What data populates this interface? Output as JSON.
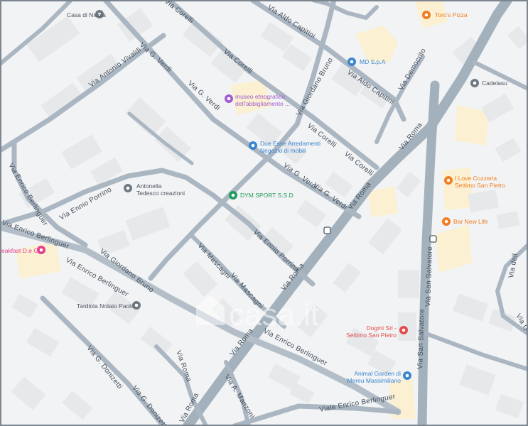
{
  "colors": {
    "background": "#f2f3f4",
    "block": "#e6e8ea",
    "building": "#dcdfe2",
    "road": "#aab6c1",
    "main_road": "#a3b1bd",
    "commercial": "#fbf0d2",
    "poi_orange": "#f07d22",
    "poi_blue": "#3a86d0",
    "poi_pink": "#e33f8f",
    "poi_purple": "#a35bd1",
    "poi_green": "#1f9c5d",
    "poi_red": "#e44a4a",
    "poi_gray": "#6f7982",
    "frame": "#7d868f"
  },
  "streets": [
    {
      "id": "via-aldo-capitini-1",
      "name": "Via Aldo Capitini"
    },
    {
      "id": "via-aldo-capitini-2",
      "name": "Via Aldo Capitini"
    },
    {
      "id": "via-corelli-1",
      "name": "Via Corelli"
    },
    {
      "id": "via-corelli-2",
      "name": "Via Corelli"
    },
    {
      "id": "via-corelli-3",
      "name": "Via Corelli"
    },
    {
      "id": "via-corelli-4",
      "name": "Via Corelli"
    },
    {
      "id": "via-g-verdi-1",
      "name": "Via G. Verdi"
    },
    {
      "id": "via-g-verdi-2",
      "name": "Via G. Verdi"
    },
    {
      "id": "via-g-verdi-3",
      "name": "Via G. Verdi"
    },
    {
      "id": "via-g-verdi-4",
      "name": "Via G. Verdi"
    },
    {
      "id": "via-antonio-vivaldi",
      "name": "Via Antonio Vivaldi"
    },
    {
      "id": "via-giordano-bruno-1",
      "name": "Via Giordano Bruno"
    },
    {
      "id": "via-giordano-bruno-2",
      "name": "Via Giordano Bruno"
    },
    {
      "id": "via-democrito",
      "name": "Via Democrito"
    },
    {
      "id": "via-roma-1",
      "name": "Via Roma"
    },
    {
      "id": "via-roma-2",
      "name": "Via Roma"
    },
    {
      "id": "via-roma-3",
      "name": "Via Roma"
    },
    {
      "id": "via-roma-4",
      "name": "Via Roma"
    },
    {
      "id": "via-roma-5",
      "name": "Via Roma"
    },
    {
      "id": "via-roma-6",
      "name": "Via Roma"
    },
    {
      "id": "via-enrico-berlinguer-1",
      "name": "Via Enrico Berlinguer"
    },
    {
      "id": "via-enrico-berlinguer-2",
      "name": "Via Enrico Berlinguer"
    },
    {
      "id": "via-enrico-berlinguer-3",
      "name": "Via Enrico Berlinguer"
    },
    {
      "id": "via-enrico-berlinguer-4",
      "name": "Via Enrico Berlinguer"
    },
    {
      "id": "via-ennio-porrino-1",
      "name": "Via Ennio Porrino"
    },
    {
      "id": "via-ennio-porrino-2",
      "name": "Via Ennio Porrino"
    },
    {
      "id": "via-mascagni-1",
      "name": "Via Mascagni"
    },
    {
      "id": "via-mascagni-2",
      "name": "Via Mascagni"
    },
    {
      "id": "via-g-donizetti-1",
      "name": "Via G. Donizetti"
    },
    {
      "id": "via-g-donizetti-2",
      "name": "Via G. Donizetti"
    },
    {
      "id": "via-a-manzoni",
      "name": "Via A. Manzoni"
    },
    {
      "id": "viale-enrico-berlinguer",
      "name": "Viale Enrico Berlinguer"
    },
    {
      "id": "via-san-salvatore-1",
      "name": "Via San Salvatore"
    },
    {
      "id": "via-san-salvatore-2",
      "name": "Via San Salvatore"
    },
    {
      "id": "via-delle-1",
      "name": "Via dell"
    },
    {
      "id": "via-g-1",
      "name": "Via G"
    }
  ],
  "pois": [
    {
      "id": "casa-di-nicola",
      "label": "Casa di Nicola",
      "sub": "",
      "icon": "place-pin",
      "color": "#6f7982"
    },
    {
      "id": "toros-pizza",
      "label": "Toro's Pizza",
      "sub": "",
      "icon": "restaurant-fork-knife",
      "color": "#f07d22"
    },
    {
      "id": "md-spa",
      "label": "MD S.p.A",
      "sub": "",
      "icon": "shopping-cart",
      "color": "#3a86d0"
    },
    {
      "id": "cadelasu",
      "label": "Cadelasu",
      "sub": "",
      "icon": "place-pin",
      "color": "#6f7982"
    },
    {
      "id": "museo",
      "label": "museo etnografico",
      "sub": "dell'abbigliamento ...",
      "icon": "museum",
      "color": "#a35bd1"
    },
    {
      "id": "due-esse",
      "label": "Due Esse Arredamenti",
      "sub": "Negozio di mobili",
      "icon": "shopping-bag",
      "color": "#3a86d0"
    },
    {
      "id": "dym-sport",
      "label": "DYM SPORT S.S.D",
      "sub": "",
      "icon": "sports",
      "color": "#1f9c5d"
    },
    {
      "id": "antonella",
      "label": "Antonella",
      "sub": "Tedesco creazioni",
      "icon": "place-pin",
      "color": "#6f7982"
    },
    {
      "id": "i-love-cozzeria",
      "label": "I Love Cozzeria",
      "sub": "Settimo San Pietro",
      "icon": "restaurant-fork-knife",
      "color": "#f07d22"
    },
    {
      "id": "bar-new-life",
      "label": "Bar New Life",
      "sub": "",
      "icon": "restaurant-fork-knife",
      "color": "#f07d22"
    },
    {
      "id": "breakfast",
      "label": "eakfast D.e G",
      "sub": "",
      "icon": "bed",
      "color": "#e33f8f"
    },
    {
      "id": "tardiola",
      "label": "Tardiola Notaio Paolo",
      "sub": "",
      "icon": "place-pin",
      "color": "#6f7982"
    },
    {
      "id": "dogmi",
      "label": "Dogmi Srl -",
      "sub": "Settimo San Pietro",
      "icon": "shopping-bag",
      "color": "#e44a4a"
    },
    {
      "id": "animal-garden",
      "label": "Animal Garden di",
      "sub": "Mereu Massimiliano",
      "icon": "shopping-bag",
      "color": "#3a86d0"
    }
  ],
  "watermark": {
    "text": "casa.it"
  }
}
